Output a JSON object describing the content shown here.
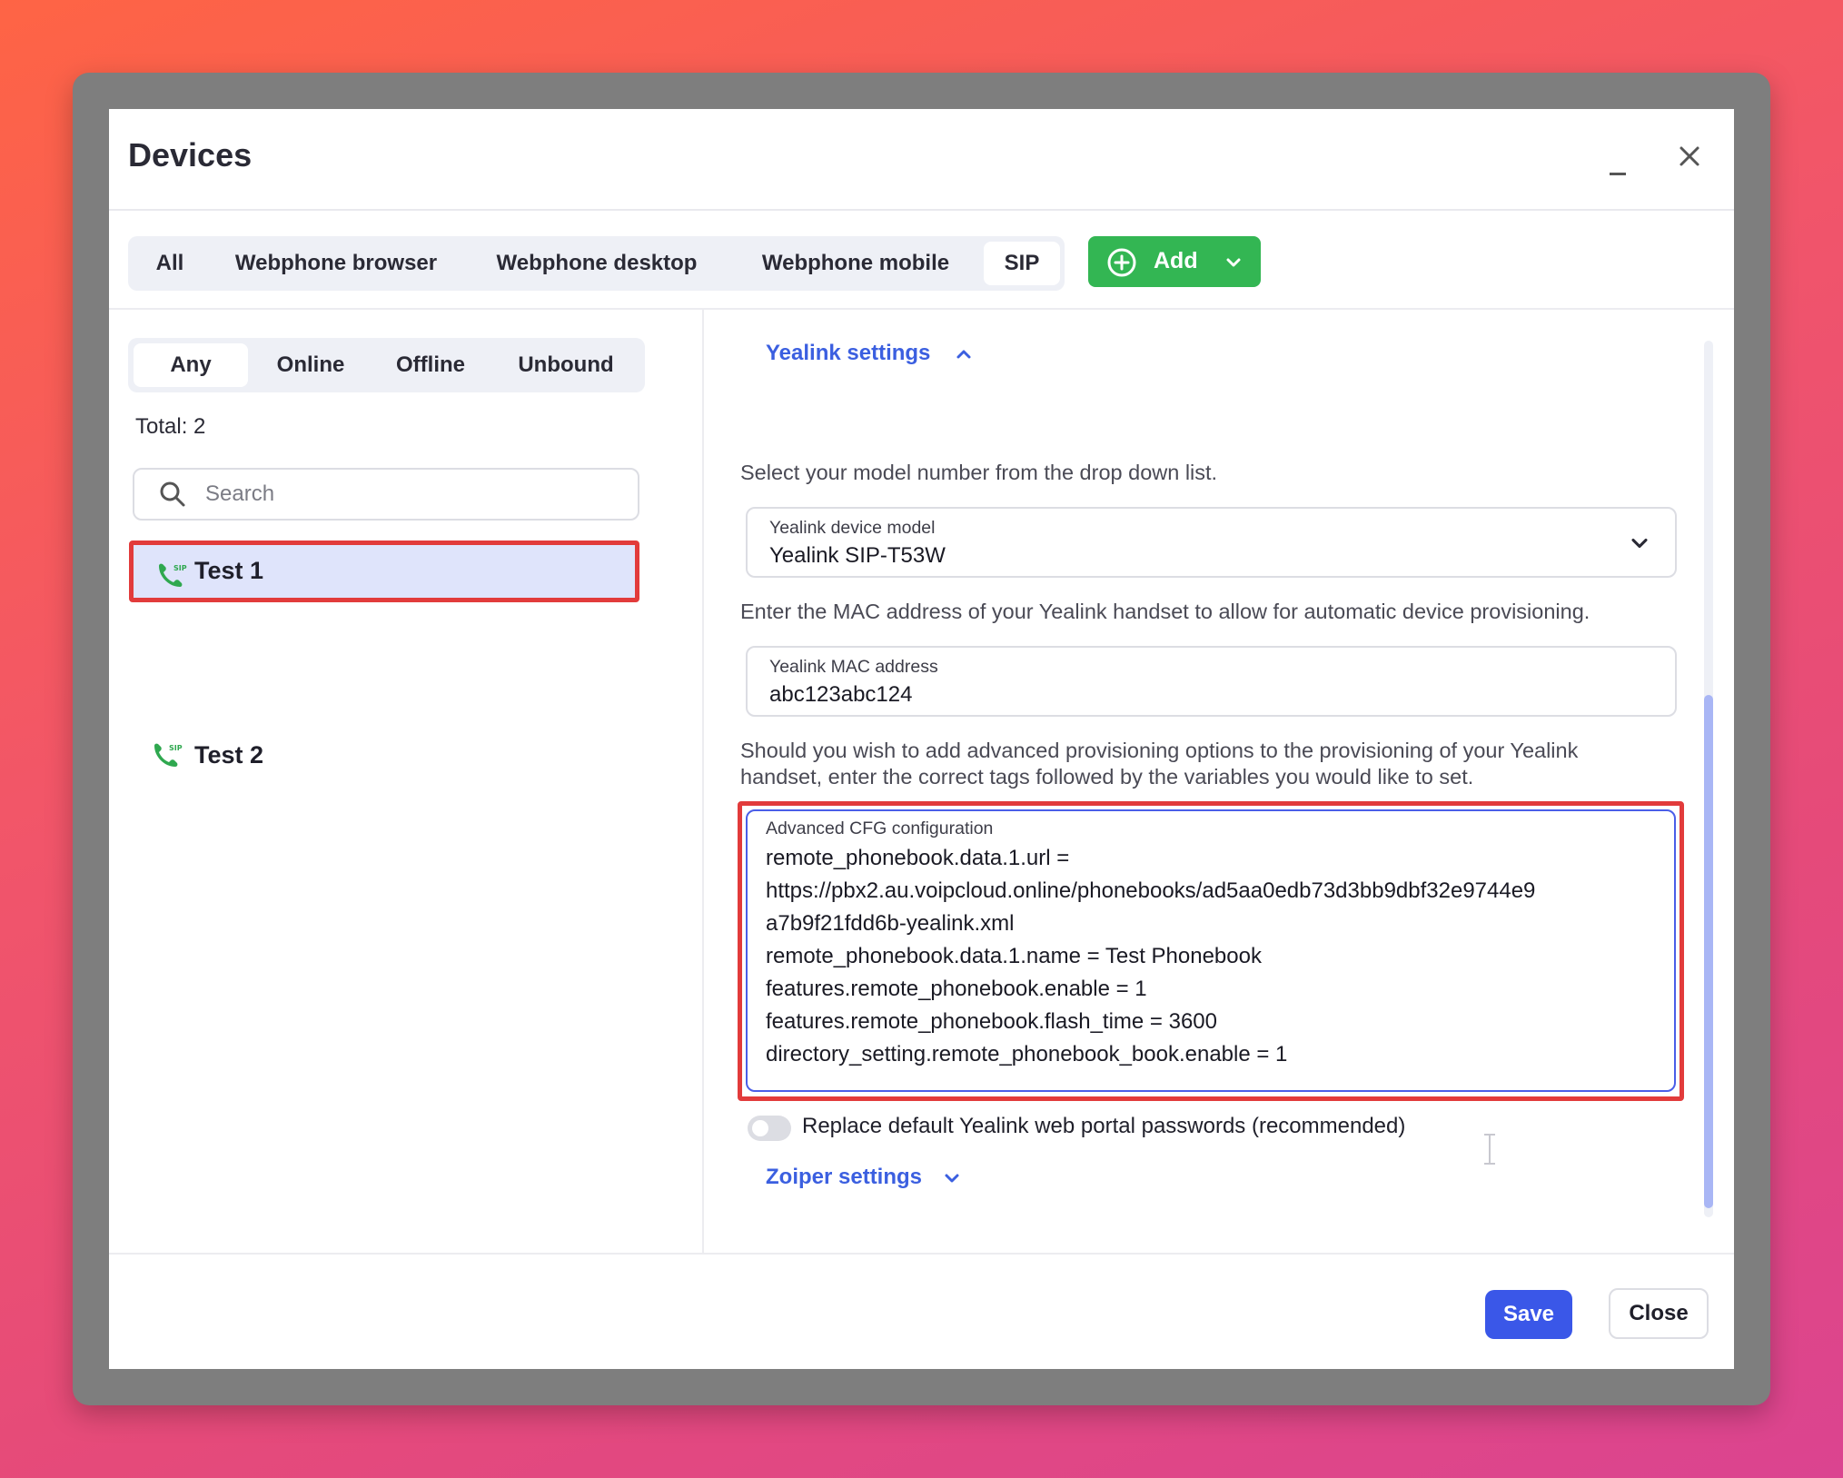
{
  "dialog": {
    "title": "Devices"
  },
  "type_tabs": [
    {
      "label": "All",
      "active": false
    },
    {
      "label": "Webphone browser",
      "active": false
    },
    {
      "label": "Webphone desktop",
      "active": false
    },
    {
      "label": "Webphone mobile",
      "active": false
    },
    {
      "label": "SIP",
      "active": true
    }
  ],
  "add_button": {
    "label": "Add",
    "color": "#33b653"
  },
  "status_tabs": [
    {
      "label": "Any",
      "active": true
    },
    {
      "label": "Online",
      "active": false
    },
    {
      "label": "Offline",
      "active": false
    },
    {
      "label": "Unbound",
      "active": false
    }
  ],
  "total_text": "Total: 2",
  "search": {
    "placeholder": "Search",
    "value": ""
  },
  "devices": [
    {
      "label": "Test 1",
      "selected": true,
      "icon": "sip-phone-icon"
    },
    {
      "label": "Test 2",
      "selected": false,
      "icon": "sip-phone-icon"
    }
  ],
  "yealink": {
    "section_title": "Yealink settings",
    "model_help": "Select your model number from the drop down list.",
    "model_label": "Yealink device model",
    "model_value": "Yealink SIP-T53W",
    "mac_help": "Enter the MAC address of your Yealink handset to allow for automatic device provisioning.",
    "mac_label": "Yealink MAC address",
    "mac_value": "abc123abc124",
    "advanced_help_1": "Should you wish to add advanced provisioning options to the provisioning of your Yealink",
    "advanced_help_2": "handset, enter the correct tags followed by the variables you would like to set.",
    "cfg_label": "Advanced CFG configuration",
    "cfg_lines": [
      "remote_phonebook.data.1.url =",
      "https://pbx2.au.voipcloud.online/phonebooks/ad5aa0edb73d3bb9dbf32e9744e9",
      "a7b9f21fdd6b-yealink.xml",
      "remote_phonebook.data.1.name = Test Phonebook",
      "features.remote_phonebook.enable = 1",
      "features.remote_phonebook.flash_time = 3600",
      "directory_setting.remote_phonebook_book.enable = 1"
    ],
    "replace_passwords_label": "Replace default Yealink web portal passwords (recommended)",
    "replace_passwords_enabled": false
  },
  "zoiper": {
    "section_title": "Zoiper settings"
  },
  "footer": {
    "save_label": "Save",
    "close_label": "Close"
  },
  "colors": {
    "accent": "#3b5fe0",
    "highlight": "#e23b3b",
    "selected_bg": "#dfe4fb"
  }
}
